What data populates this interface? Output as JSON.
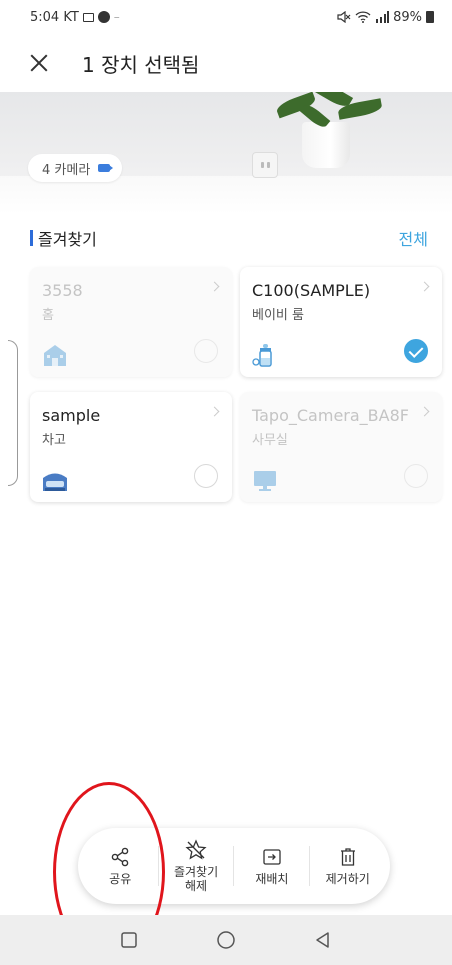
{
  "status_bar": {
    "time_carrier": "5:04 KT",
    "battery": "89%"
  },
  "header": {
    "title": "1 장치 선택됨"
  },
  "hero": {
    "camera_chip": "4 카메라"
  },
  "favorites": {
    "title": "즐겨찾기",
    "all_link": "전체"
  },
  "devices": [
    {
      "name": "3558",
      "room": "홈",
      "icon": "house-icon",
      "selected": false,
      "dimmed": true
    },
    {
      "name": "C100(SAMPLE)",
      "room": "베이비 룸",
      "icon": "baby-bottle-icon",
      "selected": true,
      "dimmed": false
    },
    {
      "name": "sample",
      "room": "차고",
      "icon": "garage-car-icon",
      "selected": false,
      "dimmed": false
    },
    {
      "name": "Tapo_Camera_BA8F",
      "room": "사무실",
      "icon": "monitor-icon",
      "selected": false,
      "dimmed": true
    }
  ],
  "actions": {
    "share": "공유",
    "unfavorite_line1": "즐겨찾기",
    "unfavorite_line2": "해제",
    "rearrange": "재배치",
    "remove": "제거하기"
  },
  "colors": {
    "accent_blue": "#3ea5df",
    "title_bar": "#2c6cd9",
    "annotation_red": "#e0151c"
  }
}
